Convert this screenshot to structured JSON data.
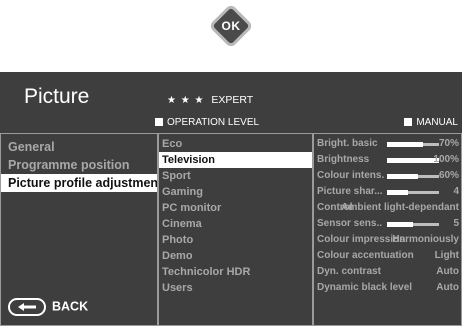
{
  "ok_button": {
    "label": "OK"
  },
  "menu": {
    "title": "Picture",
    "stars": "★ ★ ★",
    "mode": "EXPERT",
    "operation_level_label": "OPERATION LEVEL",
    "manual_label": "MANUAL",
    "back_label": "BACK"
  },
  "col1": [
    {
      "label": "General"
    },
    {
      "label": "Programme position"
    },
    {
      "label": "Picture profile adjustment",
      "selected": true
    }
  ],
  "col2": [
    {
      "label": "Eco"
    },
    {
      "label": "Television",
      "selected": true
    },
    {
      "label": "Sport"
    },
    {
      "label": "Gaming"
    },
    {
      "label": "PC monitor"
    },
    {
      "label": "Cinema"
    },
    {
      "label": "Photo"
    },
    {
      "label": "Demo"
    },
    {
      "label": "Technicolor HDR"
    },
    {
      "label": "Users"
    }
  ],
  "col3": [
    {
      "label": "Bright. basic",
      "value": "70%",
      "level": 0.7
    },
    {
      "label": "Brightness",
      "value": "100%",
      "level": 1.0
    },
    {
      "label": "Colour intens.",
      "value": "60%",
      "level": 0.6
    },
    {
      "label": "Picture shar...",
      "value": "4",
      "level": 0.4
    },
    {
      "label": "Control",
      "value": "Ambient light-dependant"
    },
    {
      "label": "Sensor sens..",
      "value": "5",
      "level": 0.5
    },
    {
      "label": "Colour impression",
      "value": "Harmoniously"
    },
    {
      "label": "Colour accentuation",
      "value": "Light"
    },
    {
      "label": "Dyn. contrast",
      "value": "Auto"
    },
    {
      "label": "Dynamic black level",
      "value": "Auto"
    }
  ]
}
